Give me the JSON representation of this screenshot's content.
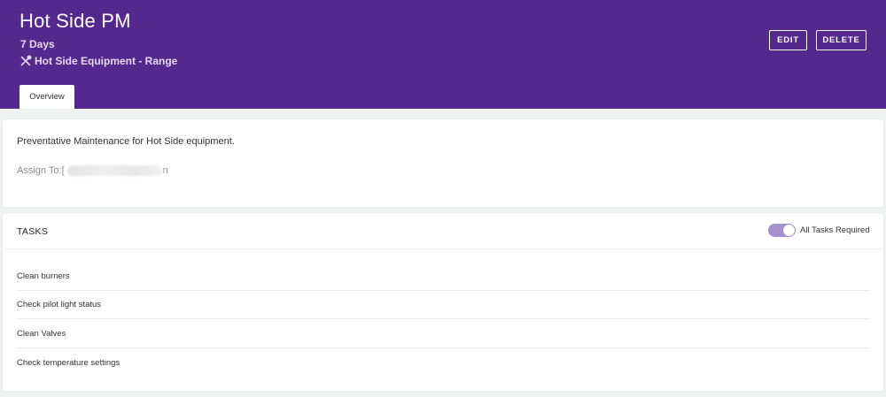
{
  "header": {
    "title": "Hot Side PM",
    "frequency": "7 Days",
    "equipment_icon": "tools-icon",
    "equipment": "Hot Side Equipment - Range",
    "edit_label": "EDIT",
    "delete_label": "DELETE",
    "colors": {
      "background": "#54288c",
      "text": "#ffffff"
    }
  },
  "tabs": [
    {
      "label": "Overview",
      "active": true
    }
  ],
  "overview": {
    "description": "Preventative Maintenance for Hot Side equipment.",
    "assign_label": "Assign To: ",
    "assign_visible_start": "[",
    "assign_visible_end": "n"
  },
  "tasks_section": {
    "title": "TASKS",
    "toggle_label": "All Tasks Required",
    "toggle_on": true,
    "toggle_color": "#a98fd0",
    "items": [
      "Clean burners",
      "Check pilot light status",
      "Clean Valves",
      "Check temperature settings"
    ]
  }
}
